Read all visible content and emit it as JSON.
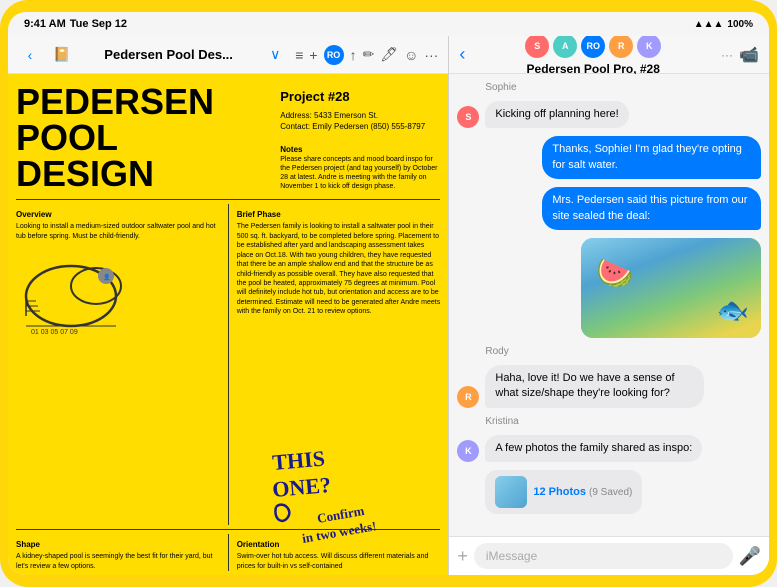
{
  "device": {
    "status_bar": {
      "time": "9:41 AM",
      "day": "Tue Sep 12",
      "wifi_signal": "●●●",
      "battery": "100%"
    }
  },
  "left_panel": {
    "toolbar": {
      "back_label": "‹",
      "doc_icon": "📄",
      "title": "Pedersen Pool Des...",
      "chevron": "∨",
      "list_icon": "≡",
      "add_icon": "+",
      "share_icon": "↑",
      "tools_icon": "✏️",
      "smiley_icon": "☺",
      "more_icon": "···"
    },
    "document": {
      "title_line1": "PEDERSEN",
      "title_line2": "POOL",
      "title_line3": "DESIGN",
      "project_number": "Project #28",
      "address": "Address: 5433 Emerson St.",
      "contact": "Contact: Emily Pedersen (850) 555-8797",
      "notes_heading": "Notes",
      "notes_text": "Please share concepts and mood board inspo for the Pedersen project (and tag yourself) by October 28 at latest. Andre is meeting with the family on November 1 to kick off design phase.",
      "overview_heading": "Overview",
      "overview_text": "Looking to install a medium-sized outdoor saltwater pool and hot tub before spring. Must be child-friendly.",
      "brief_phase_heading": "Brief Phase",
      "brief_phase_text": "The Pedersen family is looking to install a saltwater pool in their 500 sq. ft. backyard, to be completed before spring. Placement to be established after yard and landscaping assessment takes place on Oct.18.\n\nWith two young children, they have requested that there be an ample shallow end and that the structure be as child-friendly as possible overall. They have also requested that the pool be heated, approximately 75 degrees at minimum.\n\nPool will definitely include hot tub, but orientation and access are to be determined.\n\nEstimate will need to be generated after Andre meets with the family on Oct. 21 to review options.",
      "shape_heading": "Shape",
      "shape_text": "A kidney-shaped pool is seemingly the best fit for their yard, but let's review a few options.",
      "orientation_heading": "Orientation",
      "orientation_text": "Swim-over hot tub access. Will discuss different materials and prices for built-in vs self-contained",
      "handwriting_text": "THIS ONE? Confirm in two weeks!"
    }
  },
  "right_panel": {
    "toolbar": {
      "back_label": "‹",
      "three_dots": "···",
      "video_icon": "📹"
    },
    "contact": {
      "name": "Pedersen Pool Pro, #28",
      "avatars": [
        {
          "color": "#ff6b6b",
          "label": "S"
        },
        {
          "color": "#4ecdc4",
          "label": "A"
        },
        {
          "color": "#007aff",
          "label": "RO"
        },
        {
          "color": "#ff9f43",
          "label": "R"
        },
        {
          "color": "#a29bfe",
          "label": "K"
        }
      ]
    },
    "messages": [
      {
        "id": 1,
        "sender": "Sophie",
        "type": "incoming",
        "avatar_color": "#ff6b6b",
        "avatar_label": "S",
        "text": "Kicking off planning here!"
      },
      {
        "id": 2,
        "sender": "Me",
        "type": "outgoing",
        "text": "Thanks, Sophie! I'm glad they're opting for salt water."
      },
      {
        "id": 3,
        "sender": "Me",
        "type": "outgoing",
        "text": "Mrs. Pedersen said this picture from our site sealed the deal:"
      },
      {
        "id": 4,
        "sender": "Me",
        "type": "outgoing_image",
        "has_image": true
      },
      {
        "id": 5,
        "sender": "Rody",
        "type": "incoming",
        "avatar_color": "#ff9f43",
        "avatar_label": "R",
        "text": "Haha, love it! Do we have a sense of what size/shape they're looking for?"
      },
      {
        "id": 6,
        "sender": "Kristina",
        "type": "incoming",
        "avatar_color": "#a29bfe",
        "avatar_label": "K",
        "text": "A few photos the family shared as inspo:"
      },
      {
        "id": 7,
        "sender": "Kristina",
        "type": "incoming_photos",
        "avatar_color": "#a29bfe",
        "avatar_label": "K",
        "photos_label": "12 Photos",
        "photos_saved": "(9 Saved)"
      }
    ],
    "input": {
      "placeholder": "iMessage",
      "plus_icon": "+",
      "mic_icon": "🎤"
    }
  }
}
